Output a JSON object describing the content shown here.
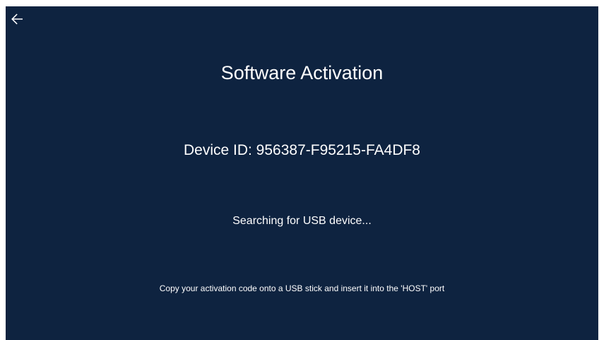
{
  "header": {
    "back_icon": "arrow-left-icon"
  },
  "main": {
    "title": "Software Activation",
    "device_id": "Device ID: 956387-F95215-FA4DF8",
    "status": "Searching for USB device...",
    "hint": "Copy your activation code onto a USB stick and insert it into the 'HOST' port"
  },
  "colors": {
    "background": "#0e2340",
    "text": "#ffffff"
  }
}
